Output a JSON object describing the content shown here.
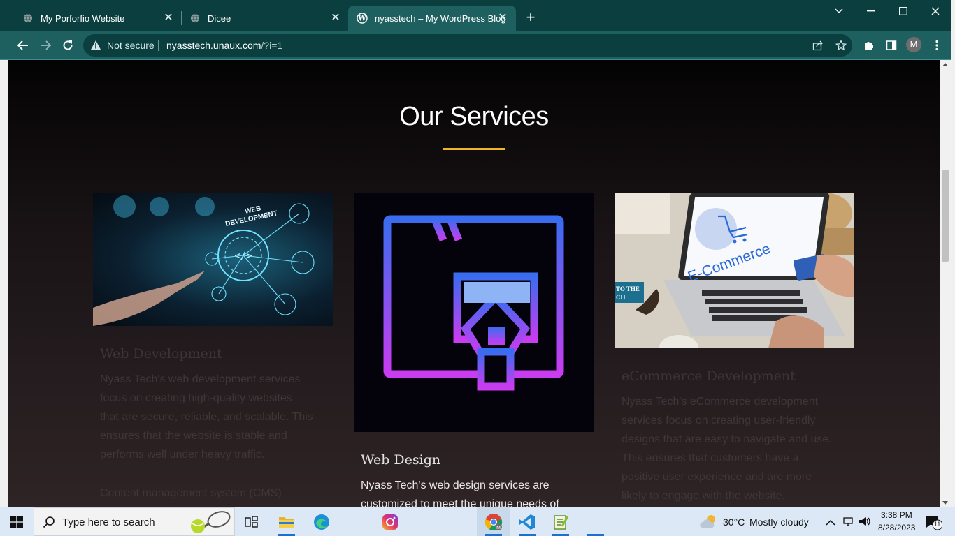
{
  "browser": {
    "tabs": [
      {
        "title": "My Porforfio Website",
        "icon": "globe-icon",
        "active": false
      },
      {
        "title": "Dicee",
        "icon": "globe-icon",
        "active": false
      },
      {
        "title": "nyasstech – My WordPress Blog",
        "icon": "wordpress-icon",
        "active": true
      }
    ],
    "security_label": "Not secure",
    "url_domain": "nyasstech.unaux.com",
    "url_path": "/?i=1",
    "profile_initial": "M",
    "accent": "#1e5f5f"
  },
  "page": {
    "section_title": "Our Services",
    "rule_color": "#f0b429",
    "cards": [
      {
        "title": "Web Development",
        "image_text": [
          "WEB",
          "DEVELOPMENT"
        ],
        "paragraph_lines": [
          "Nyass Tech's web development services",
          "focus on creating high-quality websites",
          "that are secure, reliable, and scalable. This",
          "ensures that the website is stable and",
          "performs well under heavy traffic."
        ],
        "extra": "Content management system (CMS)"
      },
      {
        "title": "Web Design",
        "paragraph_lines": [
          "Nyass Tech's web design services are",
          "customized to meet the unique needs of"
        ]
      },
      {
        "title": "eCommerce Development",
        "image_text": "E-Commerce",
        "image_sign": [
          "TO THE",
          "CH"
        ],
        "paragraph_lines": [
          "Nyass Tech's eCommerce development",
          "services focus on creating user-friendly",
          "designs that are easy to navigate and use.",
          "This ensures that customers have a",
          "positive user experience and are more",
          "likely to engage with the website."
        ]
      }
    ]
  },
  "taskbar": {
    "search_placeholder": "Type here to search",
    "weather_temp": "30°C",
    "weather_text": "Mostly cloudy",
    "time": "3:38 PM",
    "date": "8/28/2023",
    "notification_count": "11"
  }
}
